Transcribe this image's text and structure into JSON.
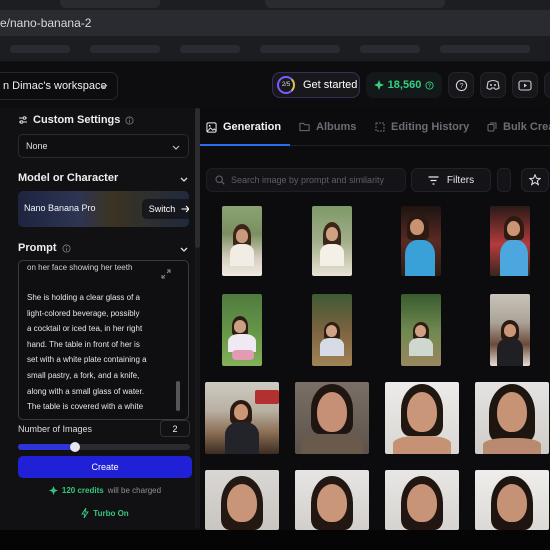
{
  "browser": {
    "url": "e/nano-banana-2"
  },
  "header": {
    "workspace": "n Dimac's workspace",
    "progress": "2/5",
    "get_started": "Get started",
    "credits": "18,560"
  },
  "sidebar": {
    "custom_settings": {
      "title": "Custom Settings",
      "value": "None"
    },
    "model": {
      "title": "Model or Character",
      "name": "Nano Banana Pro",
      "switch_label": "Switch"
    },
    "prompt": {
      "title": "Prompt",
      "cut_line": "on her face showing her teeth",
      "lines": [
        "She is holding a clear glass of a",
        "light-colored beverage, possibly",
        "a cocktail or iced tea, in her right",
        "hand. The table in front of her is",
        "set with a white plate containing a",
        "small pastry, a fork, and a knife,",
        "along with a small glass of water.",
        "The table is covered with a white"
      ]
    },
    "num_images": {
      "label": "Number of Images",
      "value": "2",
      "fraction": 0.33
    },
    "create_label": "Create",
    "charge": {
      "credits": "120 credits",
      "text": "will be charged"
    },
    "turbo": "Turbo On"
  },
  "main": {
    "tabs": [
      {
        "label": "Generation",
        "icon": "image-icon"
      },
      {
        "label": "Albums",
        "icon": "folder-icon"
      },
      {
        "label": "Editing History",
        "icon": "history-icon"
      },
      {
        "label": "Bulk Crea",
        "icon": "copy-icon"
      }
    ],
    "search_placeholder": "Search image by prompt and similarity",
    "filters_label": "Filters"
  },
  "colors": {
    "accent": "#2020d6",
    "tab_underline": "#2a6cf0",
    "credit_green": "#35d07f"
  }
}
